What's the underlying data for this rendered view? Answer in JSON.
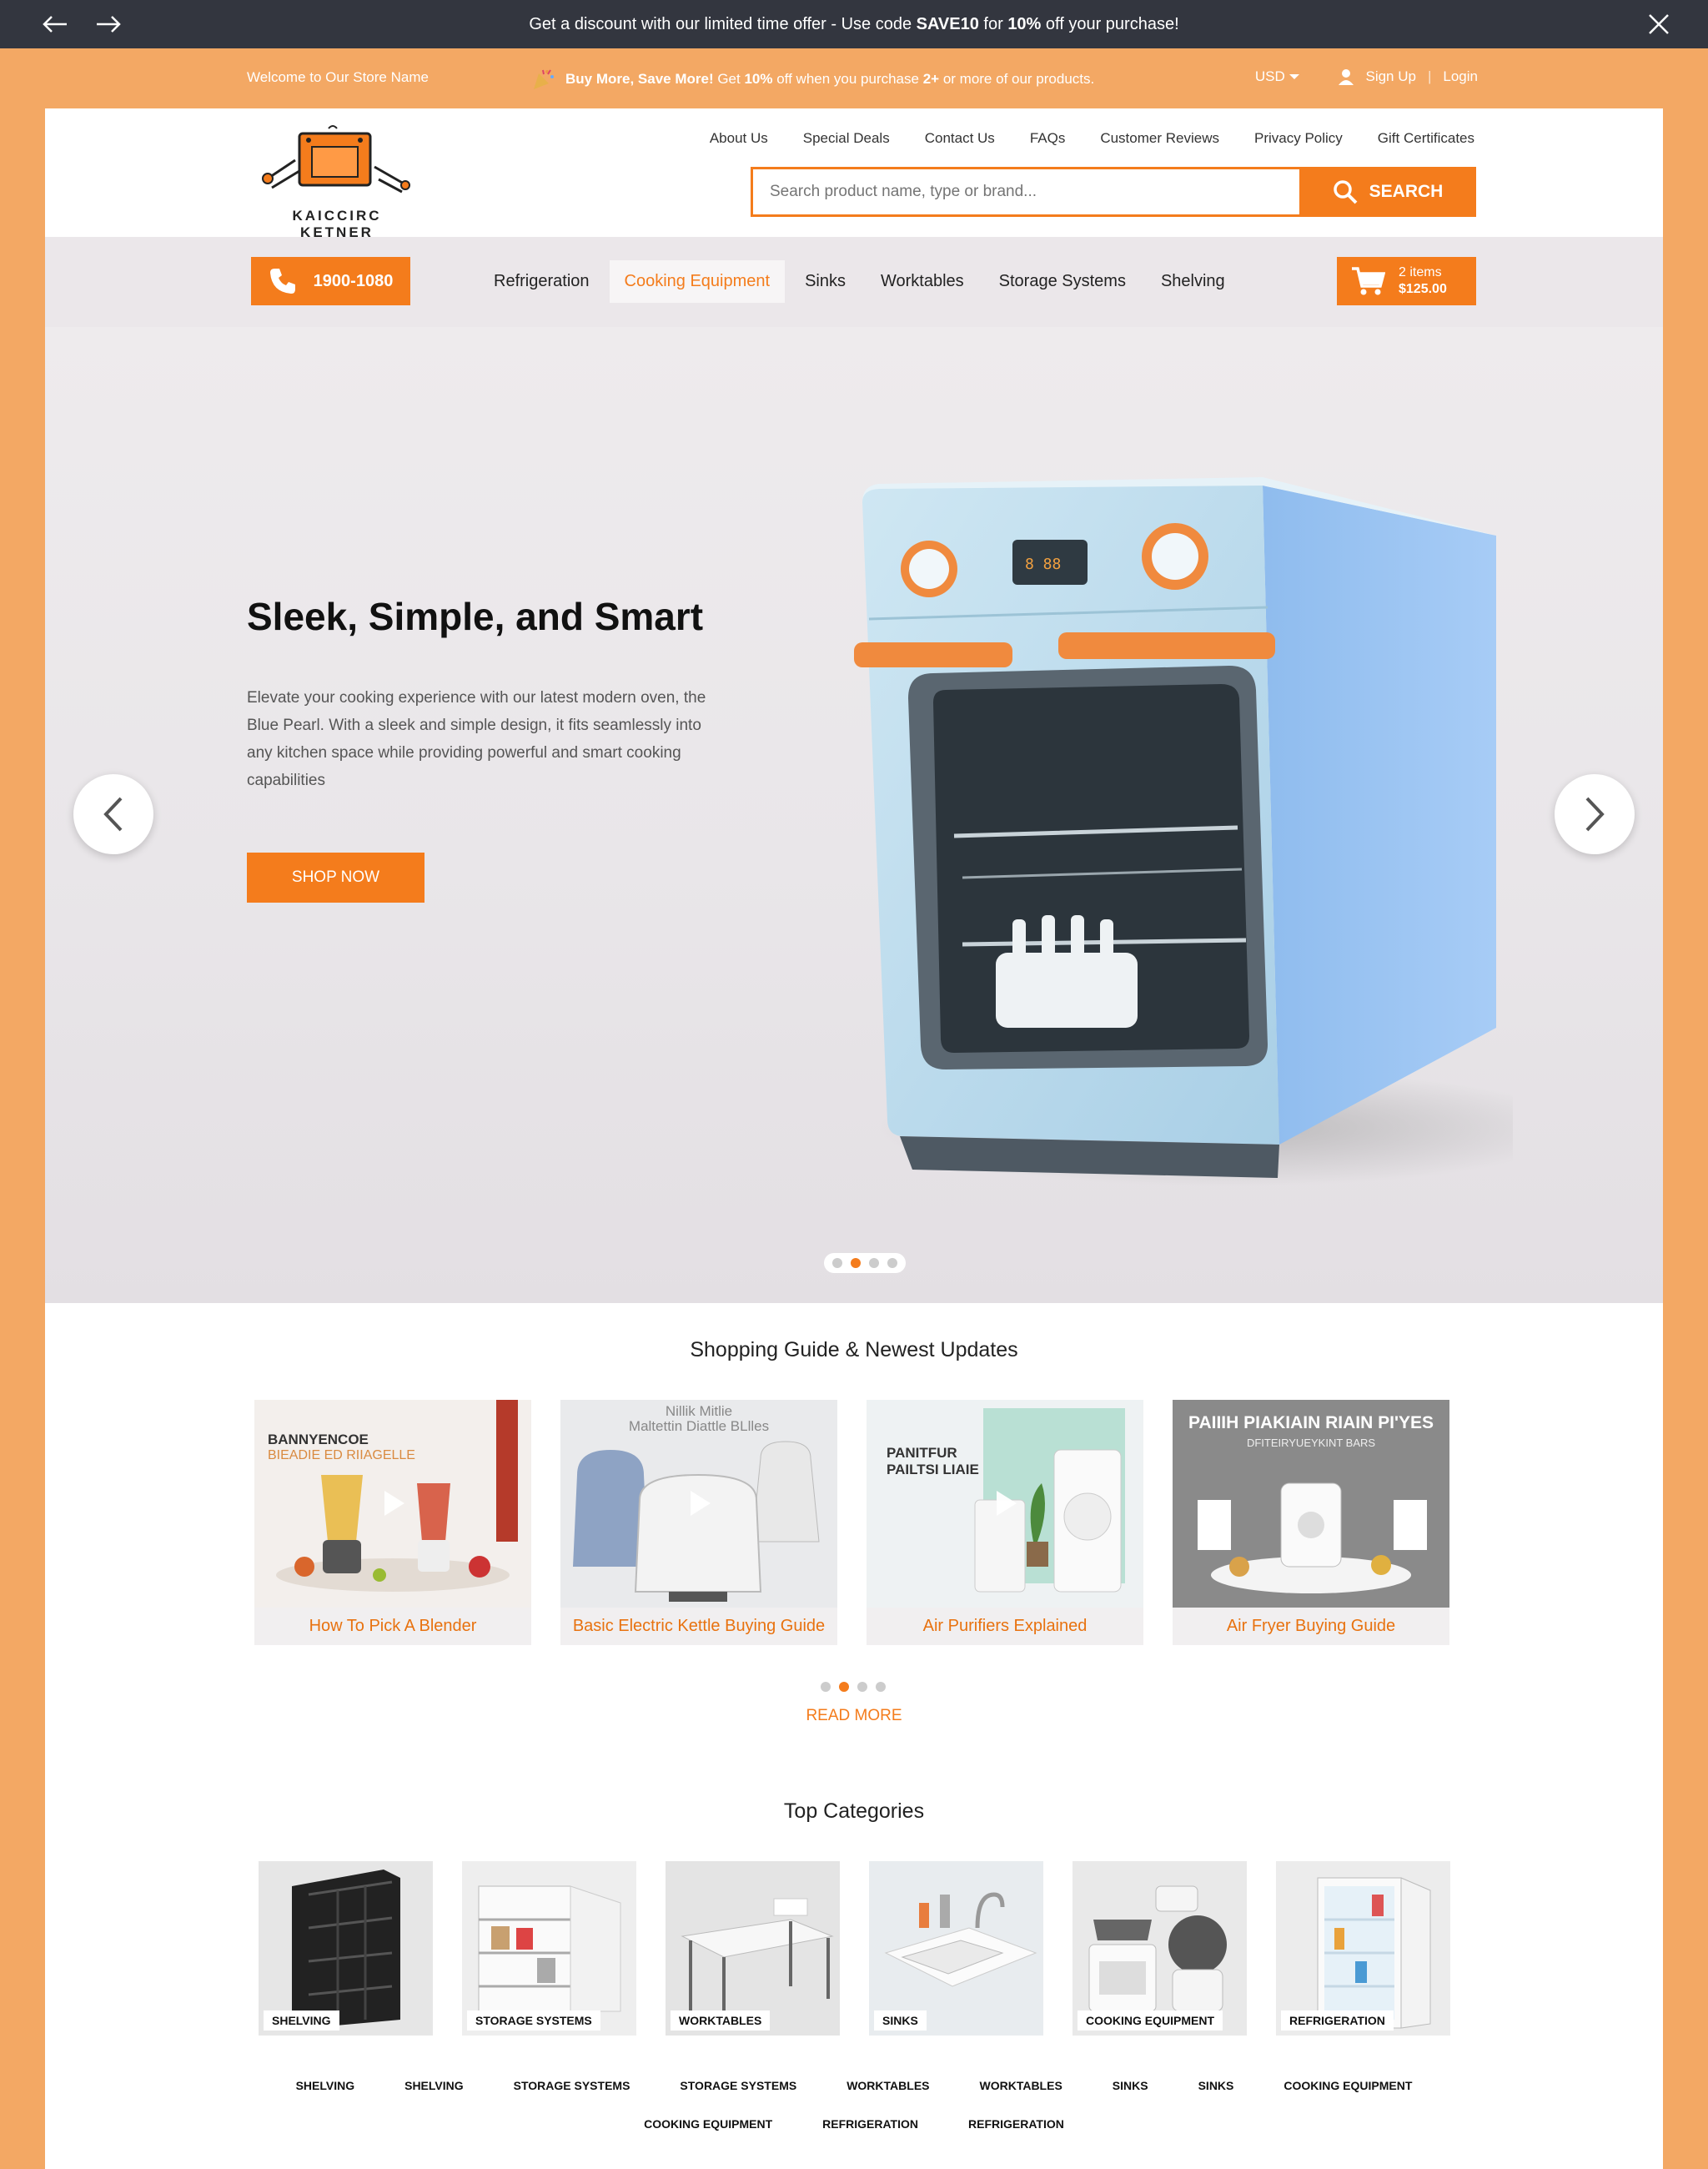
{
  "announcement": {
    "prefix": "Get a discount with our limited time offer - Use code ",
    "code": "SAVE10",
    "middle": " for ",
    "percent": "10%",
    "suffix": " off your purchase!"
  },
  "utility": {
    "welcome": "Welcome to Our Store Name",
    "promo_bold": "Buy More, Save More!",
    "promo_get": " Get ",
    "promo_pct": "10%",
    "promo_mid": " off when you purchase ",
    "promo_qty": "2+",
    "promo_end": " or more of our products.",
    "currency": "USD",
    "signup": "Sign Up",
    "login": "Login"
  },
  "header": {
    "logo_text": "KAICCIRC KETNER",
    "links": [
      "About Us",
      "Special Deals",
      "Contact Us",
      "FAQs",
      "Customer Reviews",
      "Privacy Policy",
      "Gift Certificates"
    ],
    "search_placeholder": "Search product name, type or brand...",
    "search_button": "SEARCH"
  },
  "nav": {
    "phone": "1900-1080",
    "categories": [
      "Refrigeration",
      "Cooking Equipment",
      "Sinks",
      "Worktables",
      "Storage Systems",
      "Shelving"
    ],
    "active": "Cooking Equipment",
    "cart_items": "2 items",
    "cart_total": "$125.00"
  },
  "hero": {
    "title": "Sleek, Simple, and Smart",
    "body": "Elevate your cooking experience with our latest modern oven, the Blue Pearl. With a sleek and simple design, it fits seamlessly into any kitchen space while providing powerful and smart cooking capabilities",
    "cta": "SHOP NOW",
    "slide_active": 2,
    "slide_count": 4
  },
  "guide": {
    "title": "Shopping Guide & Newest Updates",
    "items": [
      {
        "caption": "How To Pick A Blender",
        "image_text": "BANNYENCOE",
        "image_sub": "BIEADIE ED RIIAGELLE"
      },
      {
        "caption": "Basic Electric Kettle Buying Guide",
        "image_text": "Nillik Mitlie",
        "image_sub": "Maltettin Diattle BLlles"
      },
      {
        "caption": "Air Purifiers Explained",
        "image_text": "PANITFUR",
        "image_sub": "PAILTSI LIAIE"
      },
      {
        "caption": "Air Fryer Buying Guide",
        "image_text": "PAIIIH PIAKIAIN RIAIN PI'YES",
        "image_sub": "DFITEIRYUEYKINT BARS"
      }
    ],
    "read_more": "READ MORE",
    "dot_active": 2,
    "dot_count": 4
  },
  "categories": {
    "title": "Top Categories",
    "cards": [
      "SHELVING",
      "STORAGE SYSTEMS",
      "WORKTABLES",
      "SINKS",
      "COOKING EQUIPMENT",
      "REFRIGERATION"
    ],
    "links_row1": [
      "SHELVING",
      "SHELVING",
      "STORAGE SYSTEMS",
      "STORAGE SYSTEMS",
      "WORKTABLES",
      "WORKTABLES",
      "SINKS",
      "SINKS",
      "COOKING EQUIPMENT"
    ],
    "links_row2": [
      "COOKING EQUIPMENT",
      "REFRIGERATION",
      "REFRIGERATION"
    ]
  },
  "colors": {
    "accent": "#f47c1c",
    "background": "#f3a864",
    "topbar": "#33363f"
  }
}
